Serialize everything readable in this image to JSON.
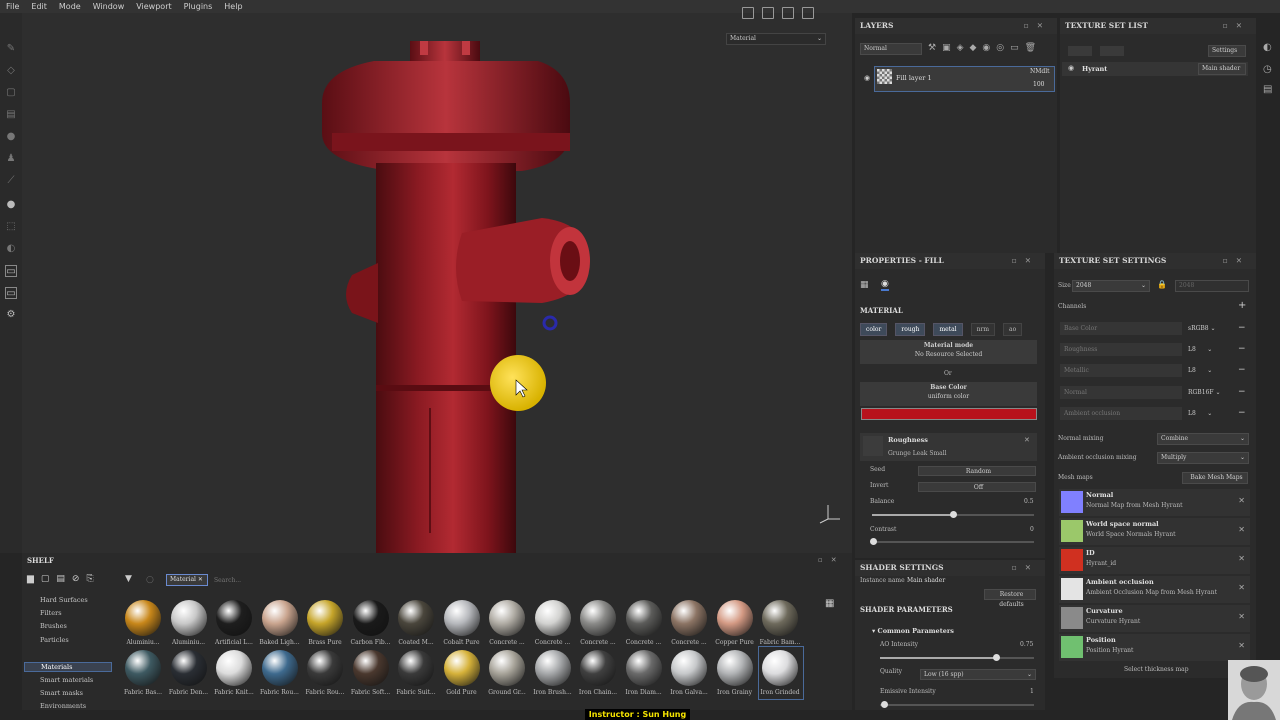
{
  "menu": [
    "File",
    "Edit",
    "Mode",
    "Window",
    "Viewport",
    "Plugins",
    "Help"
  ],
  "viewport": {
    "material_select": "Material"
  },
  "layers": {
    "title": "LAYERS",
    "blend_mode": "Normal",
    "layer_name": "Fill layer 1",
    "layer_blend": "NMdlt",
    "layer_opacity": "100"
  },
  "texture_set_list": {
    "title": "TEXTURE SET LIST",
    "settings_label": "Settings",
    "set_name": "Hyrant",
    "shader": "Main shader"
  },
  "properties": {
    "title": "PROPERTIES - FILL",
    "section": "MATERIAL",
    "channels": [
      "color",
      "rough",
      "metal",
      "nrm",
      "ao"
    ],
    "material_mode_title": "Material mode",
    "material_mode_value": "No Resource Selected",
    "or_label": "Or",
    "base_color_title": "Base Color",
    "base_color_value": "uniform color",
    "base_color_hex": "#b8121c",
    "roughness_title": "Roughness",
    "roughness_value": "Grunge Leak Small",
    "seed_label": "Seed",
    "seed_value": "Random",
    "invert_label": "Invert",
    "invert_value": "Off",
    "balance_label": "Balance",
    "balance_value": "0.5",
    "contrast_label": "Contrast",
    "contrast_value": "0"
  },
  "texture_set_settings": {
    "title": "TEXTURE SET SETTINGS",
    "size_label": "Size",
    "size_value": "2048",
    "size_ghost": "2048",
    "channels_label": "Channels",
    "channels": [
      {
        "name": "Base Color",
        "format": "sRGB8"
      },
      {
        "name": "Roughness",
        "format": "L8"
      },
      {
        "name": "Metallic",
        "format": "L8"
      },
      {
        "name": "Normal",
        "format": "RGB16F"
      },
      {
        "name": "Ambient occlusion",
        "format": "L8"
      }
    ],
    "normal_mixing_label": "Normal mixing",
    "normal_mixing_value": "Combine",
    "ao_mixing_label": "Ambient occlusion mixing",
    "ao_mixing_value": "Multiply",
    "mesh_maps_label": "Mesh maps",
    "bake_button": "Bake Mesh Maps",
    "mesh_maps": [
      {
        "title": "Normal",
        "subtitle": "Normal Map from Mesh Hyrant",
        "color": "#8080ff"
      },
      {
        "title": "World space normal",
        "subtitle": "World Space Normals Hyrant",
        "color": "#9bc86a"
      },
      {
        "title": "ID",
        "subtitle": "Hyrant_id",
        "color": "#d03020"
      },
      {
        "title": "Ambient occlusion",
        "subtitle": "Ambient Occlusion Map from Mesh Hyrant",
        "color": "#e4e4e4"
      },
      {
        "title": "Curvature",
        "subtitle": "Curvature Hyrant",
        "color": "#8a8a8a"
      },
      {
        "title": "Position",
        "subtitle": "Position Hyrant",
        "color": "#70c070"
      }
    ],
    "select_thickness": "Select thickness map"
  },
  "shader_settings": {
    "title": "SHADER SETTINGS",
    "instance_label": "Instance name",
    "instance_value": "Main shader",
    "params_title": "SHADER PARAMETERS",
    "restore": "Restore defaults",
    "common": "Common Parameters",
    "ao_intensity_label": "AO Intensity",
    "ao_intensity_value": "0.75",
    "quality_label": "Quality",
    "quality_value": "Low (16 spp)",
    "emissive_label": "Emissive Intensity",
    "emissive_value": "1"
  },
  "shelf": {
    "title": "SHELF",
    "filter_tag": "Material",
    "search_placeholder": "Search...",
    "categories": [
      "Hard Surfaces",
      "Filters",
      "Brushes",
      "Particles",
      "Materials",
      "Smart materials",
      "Smart masks",
      "Environments"
    ],
    "selected_category": "Materials",
    "materials_row1": [
      {
        "name": "Aluminiu...",
        "color": "#c8871a"
      },
      {
        "name": "Aluminiu...",
        "color": "#c8c8c8"
      },
      {
        "name": "Artificial L...",
        "color": "#1e1e1e"
      },
      {
        "name": "Baked Ligh...",
        "color": "#c9a48e"
      },
      {
        "name": "Brass Pure",
        "color": "#c6a52a"
      },
      {
        "name": "Carbon Fib...",
        "color": "#1a1a1a"
      },
      {
        "name": "Coated M...",
        "color": "#4a463c"
      },
      {
        "name": "Cobalt Pure",
        "color": "#b6b8bc"
      },
      {
        "name": "Concrete ...",
        "color": "#b0aca4"
      },
      {
        "name": "Concrete ...",
        "color": "#d2d2d0"
      },
      {
        "name": "Concrete ...",
        "color": "#8a8a88"
      },
      {
        "name": "Concrete ...",
        "color": "#5c5c5a"
      },
      {
        "name": "Concrete ...",
        "color": "#8c7464"
      },
      {
        "name": "Copper Pure",
        "color": "#d49a84"
      },
      {
        "name": "Fabric Bam...",
        "color": "#6e6a5c"
      }
    ],
    "materials_row2": [
      {
        "name": "Fabric Bas...",
        "color": "#3e5a62"
      },
      {
        "name": "Fabric Den...",
        "color": "#2a2e34"
      },
      {
        "name": "Fabric Knit...",
        "color": "#dcdcdc"
      },
      {
        "name": "Fabric Rou...",
        "color": "#3e6a8e"
      },
      {
        "name": "Fabric Rou...",
        "color": "#3a3a3a"
      },
      {
        "name": "Fabric Soft...",
        "color": "#4a382e"
      },
      {
        "name": "Fabric Suit...",
        "color": "#3a3a3a"
      },
      {
        "name": "Gold Pure",
        "color": "#d6b23a"
      },
      {
        "name": "Ground Gr...",
        "color": "#a8a49a"
      },
      {
        "name": "Iron Brush...",
        "color": "#a6a8aa"
      },
      {
        "name": "Iron Chain...",
        "color": "#404040"
      },
      {
        "name": "Iron Diam...",
        "color": "#6a6a6a"
      },
      {
        "name": "Iron Galva...",
        "color": "#c6c8ca"
      },
      {
        "name": "Iron Grainy",
        "color": "#b2b4b6"
      },
      {
        "name": "Iron Grinded",
        "color": "#dcdcde"
      }
    ]
  },
  "overlay": {
    "instructor": "Instructor : Sun Hung"
  }
}
